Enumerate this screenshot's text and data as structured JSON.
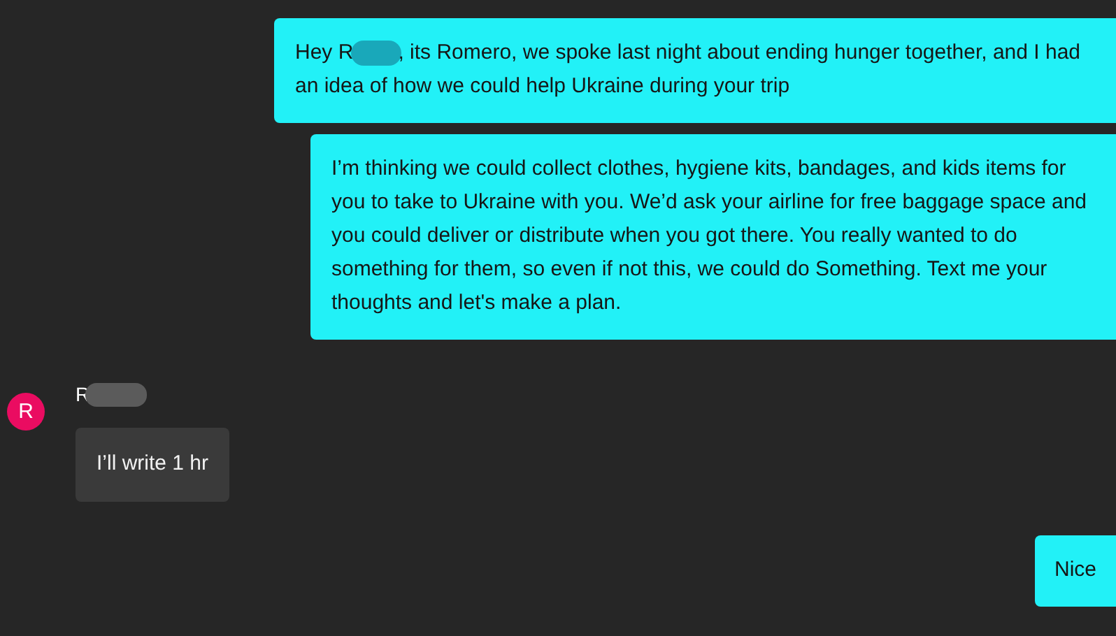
{
  "messages": [
    {
      "kind": "sent",
      "parts": [
        {
          "kind": "text",
          "text": "Hey R"
        },
        {
          "kind": "redaction"
        },
        {
          "kind": "text",
          "text": ", its Romero, we spoke last night about ending hunger together, and I had an idea of how we could help Ukraine during your trip"
        }
      ]
    },
    {
      "kind": "sent",
      "parts": [
        {
          "kind": "text",
          "text": "I’m thinking we could collect clothes, hygiene kits, bandages, and kids items for you to take to Ukraine with you. We’d ask your airline for free baggage space and you could deliver or distribute when you got there. You really wanted to do something for them, so even if not this, we could do Something. Text me your thoughts and let's make a plan."
        }
      ]
    },
    {
      "kind": "received",
      "avatar": "R",
      "sender": "R",
      "sender_redacted": true,
      "parts": [
        {
          "kind": "text",
          "text": "I’ll write 1 hr"
        }
      ]
    },
    {
      "kind": "sent",
      "parts": [
        {
          "kind": "text",
          "text": "Nice"
        }
      ]
    }
  ]
}
